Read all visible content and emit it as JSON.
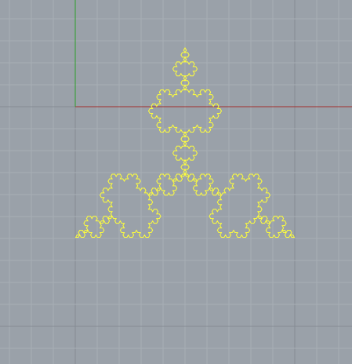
{
  "viewport": {
    "name": "perspective-viewport",
    "background_color": "#9aa1a9",
    "grid": {
      "visible": true,
      "minor_color": "#a8aeb5",
      "major_color": "#858c94"
    },
    "axes": {
      "x_axis_color": "#a3302d",
      "y_axis_color": "#2e9e2a"
    }
  },
  "curve": {
    "name": "koch-snowflake-curve",
    "type": "koch snowflake",
    "iterations": 4,
    "selected": true,
    "color": "#ffff3a"
  }
}
